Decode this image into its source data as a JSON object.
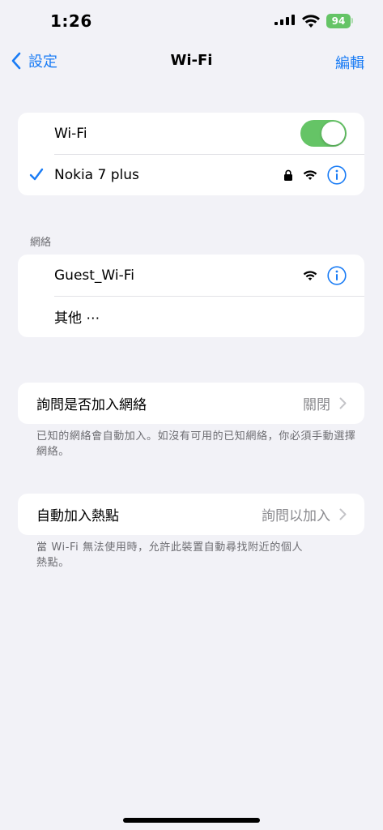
{
  "status_bar": {
    "time": "1:26",
    "battery": "94",
    "battery_color": "#65c466"
  },
  "nav": {
    "back_label": "設定",
    "title": "Wi-Fi",
    "edit_label": "編輯",
    "accent_color": "#1a7cf5"
  },
  "wifi_group": {
    "toggle_label": "Wi-Fi",
    "toggle_on": true,
    "connected_network": "Nokia 7 plus"
  },
  "networks": {
    "header": "網絡",
    "items": [
      {
        "name": "Guest_Wi-Fi"
      },
      {
        "name": "其他 ⋯"
      }
    ]
  },
  "ask_to_join": {
    "label": "詢問是否加入網絡",
    "value": "關閉",
    "footnote": "已知的網絡會自動加入。如沒有可用的已知網絡，你必須手動選擇網絡。"
  },
  "auto_hotspot": {
    "label": "自動加入熱點",
    "value": "詢問以加入",
    "footnote": "當 Wi-Fi 無法使用時，允許此裝置自動尋找附近的個人熱點。"
  },
  "icons": [
    "cell-signal-icon",
    "wifi-status-icon",
    "battery-icon",
    "back-chevron-icon",
    "checkmark-icon",
    "lock-icon",
    "wifi-icon",
    "info-icon",
    "chevron-right-icon"
  ]
}
